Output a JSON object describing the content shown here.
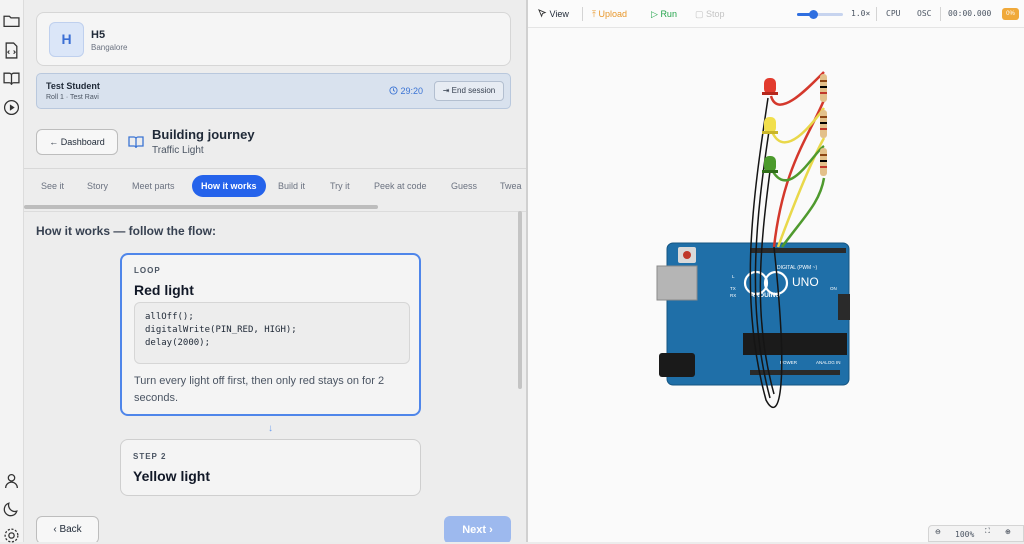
{
  "rail": {
    "icons": [
      "folder-icon",
      "file-code-icon",
      "book-open-icon",
      "play-circle-icon",
      "user-icon",
      "moon-icon",
      "settings-icon"
    ]
  },
  "school": {
    "avatar": "H",
    "name": "H5",
    "city": "Bangalore"
  },
  "session": {
    "student": "Test Student",
    "sub": "Roll 1 · Test Ravi",
    "timer": "29:20",
    "end_label": "End session"
  },
  "journey": {
    "dashboard_label": "Dashboard",
    "title": "Building journey",
    "subtitle": "Traffic Light"
  },
  "tabs": [
    "See it",
    "Story",
    "Meet parts",
    "How it works",
    "Build it",
    "Try it",
    "Peek at code",
    "Guess",
    "Twea"
  ],
  "active_tab": "How it works",
  "flow": {
    "heading": "How it works — follow the flow:",
    "steps": [
      {
        "kicker": "LOOP",
        "title": "Red light",
        "code": [
          "allOff();",
          "digitalWrite(PIN_RED, HIGH);",
          "delay(2000);"
        ],
        "desc": "Turn every light off first, then only red stays on for 2 seconds."
      },
      {
        "kicker": "STEP 2",
        "title": "Yellow light"
      }
    ]
  },
  "nav": {
    "back_label": "Back",
    "next_label": "Next"
  },
  "toolbar": {
    "view": "View",
    "upload": "Upload",
    "run": "Run",
    "stop": "Stop",
    "speed": "1.0×",
    "speed_level": 0.35,
    "cpu": "CPU",
    "osc": "OSC",
    "time": "00:00.000",
    "badge": "0%"
  },
  "board": {
    "brand": "ARDUINO",
    "model": "UNO",
    "digital_label": "DIGITAL (PWM ~)",
    "power_label": "POWER",
    "analog_label": "ANALOG IN",
    "tx": "TX",
    "rx": "RX",
    "on": "ON",
    "l": "L"
  },
  "zoom": {
    "level": "100%"
  },
  "colors": {
    "accent": "#2563eb",
    "upload": "#e8972a",
    "run": "#22a34a",
    "red_wire": "#d4382c",
    "yellow_wire": "#e9d84a",
    "green_wire": "#4f9a2e",
    "board": "#1f6fa8"
  }
}
